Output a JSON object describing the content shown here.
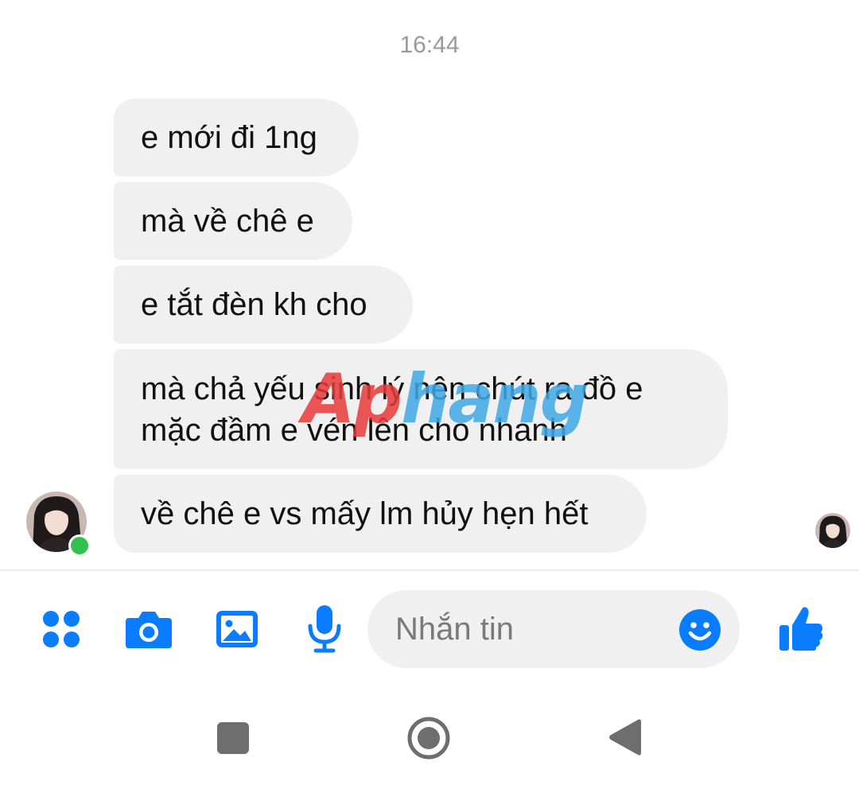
{
  "chat": {
    "timestamp": "16:44",
    "messages": [
      {
        "text": "e mới đi 1ng"
      },
      {
        "text": "mà về chê e"
      },
      {
        "text": "e tắt đèn kh cho"
      },
      {
        "lines": [
          "mà chả yếu sinh lý nên chút ra đồ e",
          "mặc đầm e vén lên cho nhanh"
        ]
      },
      {
        "text": "về chê e vs mấy lm hủy hẹn hết"
      }
    ],
    "watermark": {
      "part1": "Ap",
      "part2": "hang"
    }
  },
  "composer": {
    "placeholder": "Nhắn tin",
    "icons": [
      "apps-icon",
      "camera-icon",
      "gallery-icon",
      "microphone-icon",
      "emoji-icon",
      "thumbs-up-icon"
    ],
    "accent_color": "#0a7cff"
  },
  "navigation": {
    "icons": [
      "recent-apps-icon",
      "home-icon",
      "back-icon"
    ]
  },
  "colors": {
    "bubble": "#f0f0f0",
    "online": "#31c24d",
    "timestamp": "#9a9a9a"
  }
}
